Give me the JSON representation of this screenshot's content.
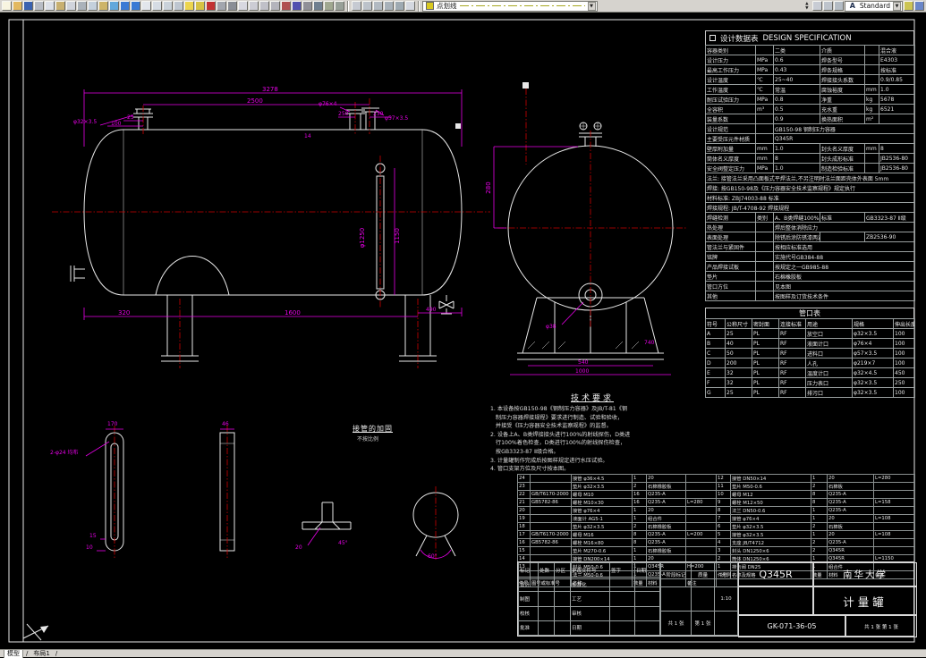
{
  "toolbar": {
    "linetype_label": "点划线",
    "style_label": "Standard",
    "icons_left": [
      {
        "name": "new",
        "color": "#f8f4e0"
      },
      {
        "name": "open",
        "color": "#e2b860"
      },
      {
        "name": "save",
        "color": "#3a62b0"
      },
      {
        "name": "plot",
        "color": "#b8bcc4"
      },
      {
        "name": "plot-preview",
        "color": "#dce0e8"
      },
      {
        "name": "publish",
        "color": "#c8b070"
      },
      {
        "name": "find",
        "color": "#d0d4dc"
      },
      {
        "name": "cut",
        "color": "#aab2ba"
      },
      {
        "name": "copy",
        "color": "#c4d0dc"
      },
      {
        "name": "paste",
        "color": "#cdb468"
      },
      {
        "name": "match-properties",
        "color": "#62a8dc"
      },
      {
        "name": "undo",
        "color": "#3a7ad4"
      },
      {
        "name": "redo",
        "color": "#3a7ad4"
      },
      {
        "name": "pan",
        "color": "#e2e6ec"
      },
      {
        "name": "zoom-realtime",
        "color": "#d6dce4"
      },
      {
        "name": "zoom-window",
        "color": "#cad2da"
      },
      {
        "name": "zoom-previous",
        "color": "#bec6d0"
      },
      {
        "name": "layer-properties",
        "color": "#ecd44e"
      },
      {
        "name": "layer-control",
        "color": "#d6c244"
      },
      {
        "name": "color-control",
        "color": "#c23232"
      },
      {
        "name": "linetype-manager",
        "color": "#a2a6ae"
      },
      {
        "name": "lineweight",
        "color": "#8a8e96"
      },
      {
        "name": "text-style",
        "color": "#d8d8e0"
      },
      {
        "name": "dim-style",
        "color": "#ccccd4"
      },
      {
        "name": "point-style",
        "color": "#c0c0c8"
      },
      {
        "name": "units",
        "color": "#b4b4bc"
      },
      {
        "name": "distance",
        "color": "#b05050"
      },
      {
        "name": "area",
        "color": "#5050b0"
      },
      {
        "name": "list",
        "color": "#909098"
      },
      {
        "name": "id-point",
        "color": "#708090"
      },
      {
        "name": "calculator",
        "color": "#a0a890"
      },
      {
        "name": "script",
        "color": "#98a098"
      }
    ],
    "icons_mid": [
      {
        "name": "dim-linear",
        "color": "#c6cad2"
      },
      {
        "name": "dim-aligned",
        "color": "#bcc2ca"
      },
      {
        "name": "dim-radius",
        "color": "#b2bac2"
      },
      {
        "name": "dim-angular",
        "color": "#a8b2ba"
      },
      {
        "name": "quick-dim",
        "color": "#9eaab2"
      },
      {
        "name": "mtext",
        "color": "#d4d8e0"
      }
    ],
    "icons_osnap": [
      {
        "name": "osnap",
        "color": "#c8ccd4"
      },
      {
        "name": "ortho",
        "color": "#bec4cc"
      },
      {
        "name": "polar",
        "color": "#b4bcc4"
      }
    ],
    "icons_end": [
      {
        "name": "style-manager",
        "color": "#ccc454"
      },
      {
        "name": "help",
        "color": "#6a86c8"
      }
    ]
  },
  "statusbar": {
    "model_tab": "模型",
    "layout_tab": "布局1",
    "separator": "/"
  },
  "drawing": {
    "dims": {
      "d3278": "3278",
      "d2500": "2500",
      "d25": "25",
      "d100": "100",
      "n32": "φ32×3.5",
      "n76": "φ76×4",
      "d250": "250",
      "d230": "230",
      "n57": "φ57×3.5",
      "d14": "14",
      "d1150": "1150",
      "d1250": "φ1250",
      "d320": "320",
      "d1600": "1600",
      "d490": "490",
      "d280": "280",
      "n38": "φ38",
      "d540": "540",
      "d1000": "1000",
      "d740": "740",
      "d170": "170",
      "h24": "2-φ24 均布",
      "d15": "15",
      "d10": "10",
      "d46": "46",
      "d20": "20",
      "a45": "45°",
      "a60": "60°"
    },
    "labels": {
      "detail_title": "接管的加固",
      "detail_scale": "不按比例"
    },
    "tech_req": {
      "title": "技术要求",
      "lines": [
        "1. 本设备按GB150-98《钢制压力容器》及JB/T-81《钢",
        "   制压力容器焊接规程》要求进行制造、试验和验收，",
        "   并接受《压力容器安全技术监察规程》的监督。",
        "2. 设备上A、B类焊接接头进行100%的射线探伤，D类进",
        "   行100%着色检查，D类进行100%的射线探伤检查，",
        "   按GB3323-87 Ⅱ级合格。",
        "3. 计量罐制作完成后按图样规定进行水压试验。",
        "4. 管口支架方位及尺寸按本图。"
      ]
    }
  },
  "spec_table": {
    "title": "设计数据表",
    "title_en": "DESIGN  SPECIFICATION",
    "rows": [
      [
        "容器类别",
        "",
        "二类",
        "介质",
        "",
        "混合液"
      ],
      [
        "设计压力",
        "MPa",
        "0.6",
        "焊条型号",
        "",
        "E4303"
      ],
      [
        "最高工作压力",
        "MPa",
        "0.43",
        "焊条规格",
        "",
        "按标准"
      ],
      [
        "设计温度",
        "℃",
        "25~40",
        "焊接接头系数",
        "",
        "0.9/0.85"
      ],
      [
        "工作温度",
        "℃",
        "常温",
        "腐蚀裕度",
        "mm",
        "1.0"
      ],
      [
        "耐压试验压力",
        "MPa",
        "0.8",
        "净重",
        "kg",
        "5678"
      ],
      [
        "全容积",
        "m³",
        "0.5",
        "充水重",
        "kg",
        "6521"
      ],
      [
        "装量系数",
        "",
        "0.9",
        "换热面积",
        "m²",
        ""
      ],
      [
        "设计规范",
        "",
        "GB150-98 钢制压力容器"
      ],
      [
        "主要受压元件材质",
        "",
        "Q345R"
      ],
      [
        "壁厚附加量",
        "mm",
        "1.0",
        "封头名义厚度",
        "mm",
        "8"
      ],
      [
        "筒体名义厚度",
        "mm",
        "8",
        "封头成形标准",
        "",
        "JB2536-80"
      ],
      [
        "安全阀整定压力",
        "MPa",
        "1.0",
        "制造检验标准",
        "",
        "JB2536-80"
      ],
      [
        "法兰: 接管法兰采用凸面板式平焊法兰,不另注明时法兰面距壳体外表面 5mm"
      ],
      [
        "焊接: 按GB150-98及《压力容器安全技术监察规程》规定执行"
      ],
      [
        "材料标准: ZBJ74003-88 标准"
      ],
      [
        "焊接规程: JB/T-4708-92 焊接规程"
      ],
      [
        "焊缝检测",
        "类别",
        "A、B类焊缝100%射线探伤",
        "标准",
        "GB3323-87 Ⅱ级"
      ],
      [
        "热处理",
        "",
        "焊后整体消除应力"
      ],
      [
        "表面处理",
        "",
        "除锈后涂防锈漆两遍",
        "",
        "ZB2536-90"
      ],
      [
        "管法兰与紧固件",
        "",
        "按相应标准选用"
      ],
      [
        "铭牌",
        "",
        "实施代号GB384-88"
      ],
      [
        "产品焊接试板",
        "",
        "按规定之一GB985-88"
      ],
      [
        "垫片",
        "",
        "石棉橡胶板"
      ],
      [
        "管口方位",
        "",
        "见本图"
      ],
      [
        "其他",
        "",
        "按图样及订货技术条件"
      ]
    ]
  },
  "nozzle_table": {
    "title": "管口表",
    "header_row": [
      [
        "符号",
        "公称尺寸",
        "密封面",
        "连接标准",
        "用途",
        "规格",
        "伸出长度"
      ]
    ],
    "rows": [
      [
        "A",
        "25",
        "PL",
        "RF",
        "放空口",
        "φ32×3.5",
        "100"
      ],
      [
        "B",
        "40",
        "PL",
        "RF",
        "液面计口",
        "φ76×4",
        "100"
      ],
      [
        "C",
        "50",
        "PL",
        "RF",
        "进料口",
        "φ57×3.5",
        "100"
      ],
      [
        "D",
        "200",
        "PL",
        "RF",
        "人孔",
        "φ219×7",
        "100"
      ],
      [
        "E",
        "32",
        "PL",
        "RF",
        "温度计口",
        "φ32×4.5",
        "450"
      ],
      [
        "F",
        "32",
        "PL",
        "RF",
        "压力表口",
        "φ32×3.5",
        "250"
      ],
      [
        "G",
        "25",
        "PL",
        "RF",
        "排污口",
        "φ32×3.5",
        "100"
      ]
    ]
  },
  "bom_left": {
    "rows": [
      [
        "24",
        "",
        "接管 φ36×4.5",
        "1",
        "20",
        ""
      ],
      [
        "23",
        "",
        "垫片 φ32×3.5",
        "2",
        "石棉橡胶板",
        ""
      ],
      [
        "22",
        "GB/T6170-2000",
        "螺母 M10",
        "16",
        "Q235-A",
        ""
      ],
      [
        "21",
        "GB5782-86",
        "螺栓 M10×30",
        "16",
        "Q235-A",
        "L=280"
      ],
      [
        "20",
        "",
        "接管 φ76×4",
        "1",
        "20",
        ""
      ],
      [
        "19",
        "",
        "液面计 AG5-1",
        "1",
        "组合件",
        ""
      ],
      [
        "18",
        "",
        "垫片 φ32×3.5",
        "2",
        "石棉橡胶板",
        ""
      ],
      [
        "17",
        "GB/T6170-2000",
        "螺母 M16",
        "8",
        "Q235-A",
        "L=200"
      ],
      [
        "16",
        "GB5782-86",
        "螺栓 M16×80",
        "8",
        "Q235-A",
        ""
      ],
      [
        "15",
        "",
        "垫片 M270-0.6",
        "1",
        "石棉橡胶板",
        ""
      ],
      [
        "14",
        "",
        "接管 DN200×14",
        "1",
        "20",
        ""
      ],
      [
        "13",
        "",
        "封头 M50-0.6",
        "1",
        "Q345R",
        "H=200"
      ],
      [
        "",
        "",
        "法兰 M50-0.6",
        "1",
        "Q235-A",
        ""
      ]
    ],
    "footer": [
      [
        "件号",
        "图号或标准号",
        "名称",
        "数量",
        "材料",
        "备注"
      ]
    ]
  },
  "bom_right": {
    "rows": [
      [
        "12",
        "接管 DN50×14",
        "1",
        "20",
        "L=280"
      ],
      [
        "11",
        "垫片 M50-0.6",
        "2",
        "石棉板",
        ""
      ],
      [
        "10",
        "螺母 M12",
        "8",
        "Q235-A",
        ""
      ],
      [
        "9",
        "螺栓 M12×50",
        "8",
        "Q235-A",
        "L=158"
      ],
      [
        "8",
        "法兰 DN50-0.6",
        "1",
        "Q235-A",
        ""
      ],
      [
        "7",
        "接管 φ76×4",
        "1",
        "20",
        "L=108"
      ],
      [
        "6",
        "垫片 φ32×3.5",
        "2",
        "石棉板",
        ""
      ],
      [
        "5",
        "接管 φ32×3.5",
        "1",
        "20",
        "L=108"
      ],
      [
        "4",
        "支座 JB/T4712",
        "2",
        "Q235-A",
        ""
      ],
      [
        "3",
        "封头 DN1250×6",
        "2",
        "Q345R",
        ""
      ],
      [
        "2",
        "筒体 DN1250×6",
        "1",
        "Q345R",
        "L=1150"
      ],
      [
        "1",
        "排污阀 DN25",
        "1",
        "组合件",
        ""
      ]
    ],
    "footer": [
      [
        "件号",
        "名称及规格",
        "数量",
        "材料",
        "备注"
      ]
    ]
  },
  "title_block": {
    "material": "Q345R",
    "company": "南华大学",
    "drawing_title": "计量罐",
    "drawing_no": "GK-071-36-05",
    "sheet": "共 1 张  第 1 张",
    "rev_rows": [
      [
        "标记",
        "处数",
        "分区",
        "更改文件号",
        "签字",
        "日期"
      ],
      [
        "设计",
        "",
        "",
        "标准化",
        "",
        ""
      ],
      [
        "制图",
        "",
        "",
        "工艺",
        "",
        ""
      ],
      [
        "校核",
        "",
        "",
        "审核",
        "",
        ""
      ],
      [
        "批准",
        "",
        "",
        "日期",
        "",
        ""
      ]
    ],
    "mid_rows": [
      [
        "阶段标记",
        "质量",
        "比例"
      ],
      [
        "",
        "",
        "1:10"
      ],
      [
        "共 1 张",
        "第 1 张",
        ""
      ]
    ]
  }
}
